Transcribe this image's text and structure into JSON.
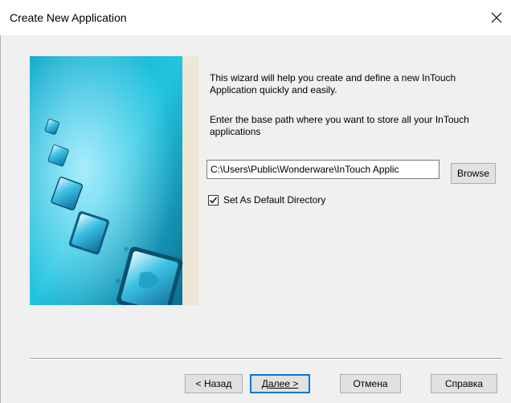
{
  "window": {
    "title": "Create New Application"
  },
  "wizard": {
    "intro_text": "This wizard will help you create and define a new InTouch Application quickly and easily.",
    "path_prompt": "Enter the base path where you want to store all your InTouch applications",
    "path_value": "C:\\Users\\Public\\Wonderware\\InTouch Applic",
    "browse_label": "Browse",
    "default_dir_label": "Set As Default Directory",
    "default_dir_checked": true
  },
  "buttons": {
    "back_label": "< Назад",
    "next_label": "Далее >",
    "cancel_label": "Отмена",
    "help_label": "Справка"
  }
}
